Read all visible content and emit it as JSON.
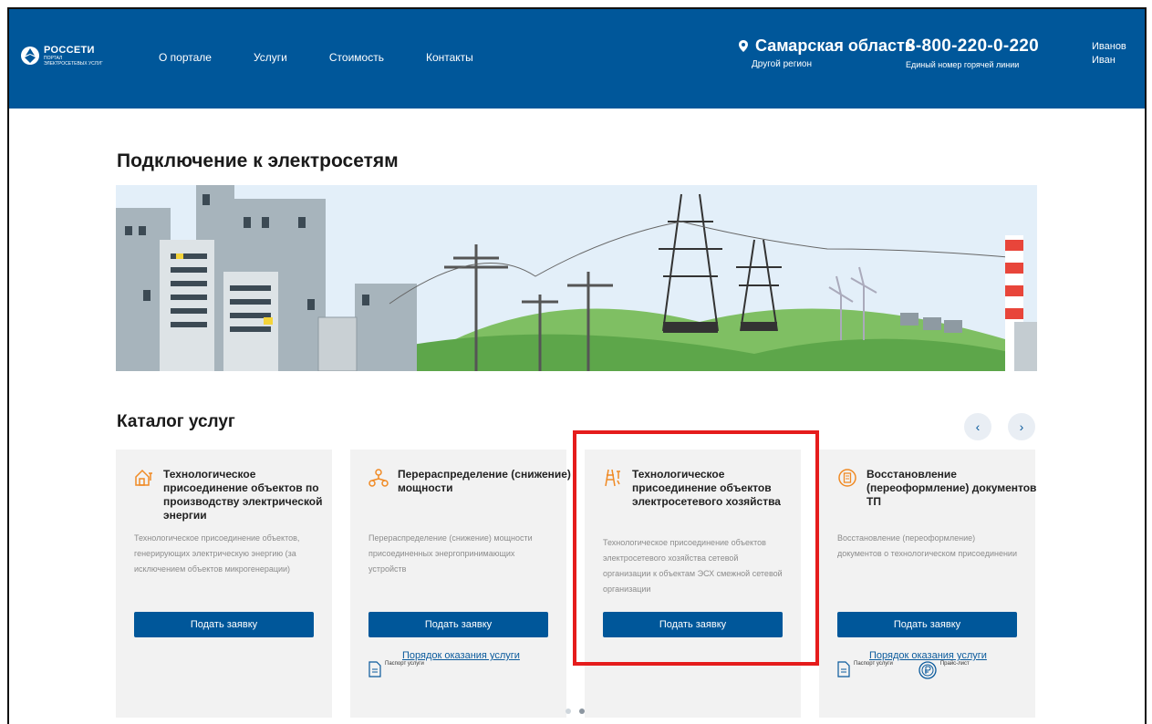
{
  "header": {
    "brand": "РОССЕТИ",
    "brand_sub_1": "ПОРТАЛ",
    "brand_sub_2": "ЭЛЕКТРОСЕТЕВЫХ УСЛУГ",
    "nav": [
      "О портале",
      "Услуги",
      "Стоимость",
      "Контакты"
    ],
    "region": "Самарская область",
    "region_other": "Другой регион",
    "phone": "8-800-220-0-220",
    "phone_caption": "Единый номер горячей линии",
    "user_last": "Иванов",
    "user_first": "Иван"
  },
  "page": {
    "title": "Подключение к электросетям",
    "catalog_title": "Каталог услуг",
    "prev": "‹",
    "next": "›"
  },
  "cards": [
    {
      "title": "Технологическое присоединение объектов по производству электрической энергии",
      "desc": "Технологическое присоединение объектов, генерирующих электрическую энергию (за исключением объектов микрогенерации)",
      "button": "Подать заявку",
      "icon": "house-plug-icon"
    },
    {
      "title": "Перераспределение (снижение) мощности",
      "desc": "Перераспределение (снижение) мощности присоединенных энергопринимающих устройств",
      "button": "Подать заявку",
      "link": "Порядок оказания услуги",
      "doc1": "Паспорт услуги",
      "icon": "redistribution-icon"
    },
    {
      "title": "Технологическое присоединение объектов электросетевого хозяйства",
      "desc": "Технологическое присоединение объектов электросетевого хозяйства сетевой организации к объектам ЭСХ смежной сетевой организации",
      "button": "Подать заявку",
      "icon": "power-tower-icon"
    },
    {
      "title": "Восстановление (переоформление) документов ТП",
      "desc": "Восстановление (переоформление) документов о технологическом присоединении",
      "button": "Подать заявку",
      "link": "Порядок оказания услуги",
      "doc1": "Паспорт услуги",
      "doc2": "Прайс-лист",
      "icon": "document-icon"
    }
  ],
  "colors": {
    "header": "#00579a",
    "accent": "#f08a24",
    "highlight": "#e51c1c"
  }
}
